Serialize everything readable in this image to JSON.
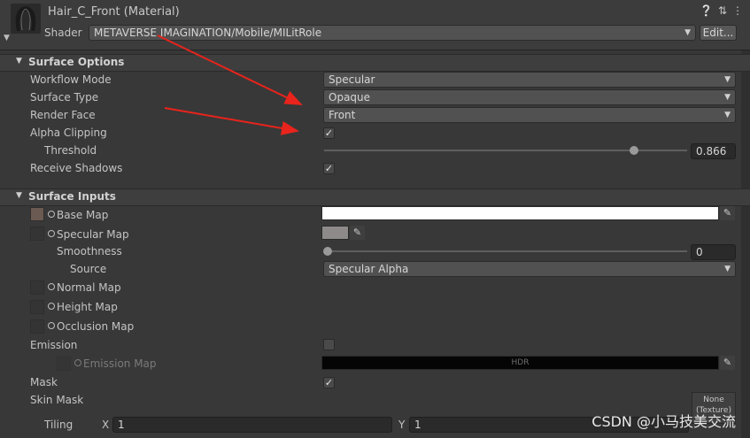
{
  "header": {
    "title": "Hair_C_Front (Material)",
    "shader_label": "Shader",
    "shader_value": "METAVERSE IMAGINATION/Mobile/MILitRole",
    "edit_label": "Edit...",
    "icons": [
      "help-icon",
      "preset-icon",
      "more-icon"
    ]
  },
  "surface_options": {
    "title": "Surface Options",
    "workflow_mode_label": "Workflow Mode",
    "workflow_mode_value": "Specular",
    "surface_type_label": "Surface Type",
    "surface_type_value": "Opaque",
    "render_face_label": "Render Face",
    "render_face_value": "Front",
    "alpha_clipping_label": "Alpha Clipping",
    "alpha_clipping_checked": true,
    "threshold_label": "Threshold",
    "threshold_value": "0.866",
    "receive_shadows_label": "Receive Shadows",
    "receive_shadows_checked": true
  },
  "surface_inputs": {
    "title": "Surface Inputs",
    "base_map_label": "Base Map",
    "specular_map_label": "Specular Map",
    "smoothness_label": "Smoothness",
    "smoothness_value": "0",
    "source_label": "Source",
    "source_value": "Specular Alpha",
    "normal_map_label": "Normal Map",
    "height_map_label": "Height Map",
    "occlusion_map_label": "Occlusion Map",
    "emission_label": "Emission",
    "emission_map_label": "Emission Map",
    "hdr_label": "HDR",
    "mask_label": "Mask",
    "skin_mask_label": "Skin Mask",
    "none_texture_line1": "None",
    "none_texture_line2": "(Texture)",
    "tiling_label": "Tiling",
    "tiling_x_label": "X",
    "tiling_x_value": "1",
    "tiling_y_label": "Y",
    "tiling_y_value": "1"
  },
  "watermark": "CSDN @小马技美交流",
  "colors": {
    "specular_color": "#8e8a8a",
    "base_color": "#ffffff",
    "arrow_color": "#e8241c"
  }
}
